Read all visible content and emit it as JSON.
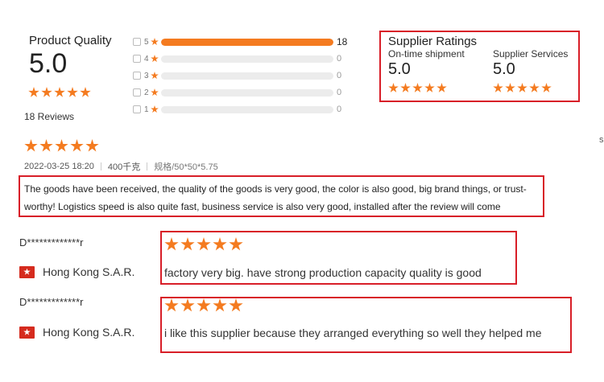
{
  "summary": {
    "label": "Product Quality",
    "score": "5.0",
    "reviews_text": "18 Reviews"
  },
  "histogram": [
    {
      "star": "5",
      "count": "18",
      "fraction": 1.0
    },
    {
      "star": "4",
      "count": "0",
      "fraction": 0
    },
    {
      "star": "3",
      "count": "0",
      "fraction": 0
    },
    {
      "star": "2",
      "count": "0",
      "fraction": 0
    },
    {
      "star": "1",
      "count": "0",
      "fraction": 0
    }
  ],
  "supplier": {
    "title": "Supplier Ratings",
    "ontime_label": "On-time shipment",
    "ontime_score": "5.0",
    "services_label": "Supplier Services",
    "services_score": "5.0"
  },
  "featured_review": {
    "date": "2022-03-25 18:20",
    "weight": "400千克",
    "spec": "规格/50*50*5.75",
    "text": "The goods have been received, the quality of the goods is very good, the color is also good, big brand things, or trust-worthy! Logistics speed is also quite fast, business service is also very good, installed after the review will come"
  },
  "reviews": [
    {
      "user": "D*************r",
      "country": "Hong Kong S.A.R.",
      "text": "factory very big. have strong production capacity quality is good"
    },
    {
      "user": "D*************r",
      "country": "Hong Kong S.A.R.",
      "text": "i like this supplier because they arranged everything so well they helped me"
    }
  ],
  "edge_char": "s",
  "colors": {
    "accent": "#f47b20",
    "highlight_box": "#d81e28"
  }
}
